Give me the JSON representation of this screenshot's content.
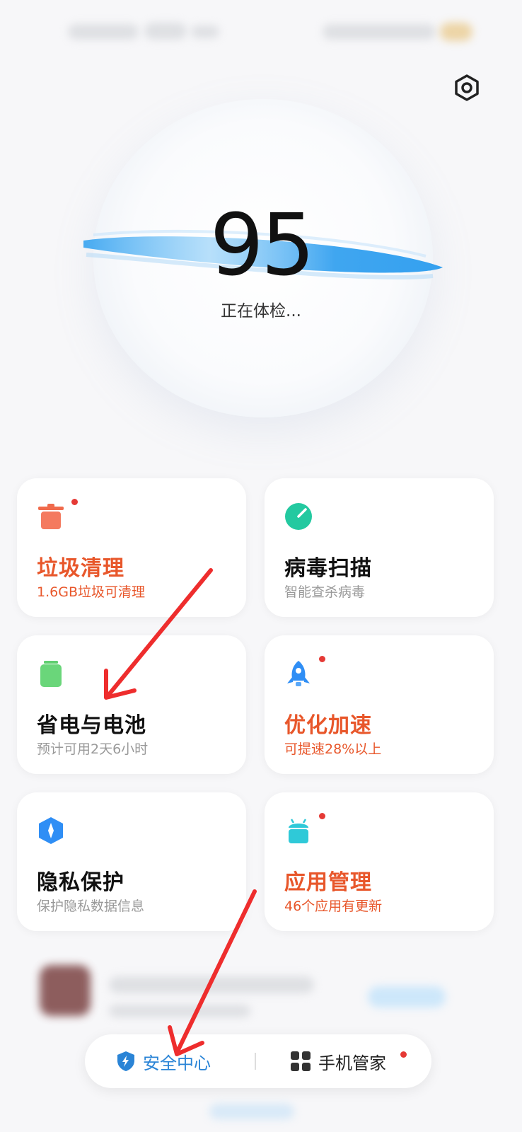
{
  "score": {
    "value": "95",
    "status": "正在体检..."
  },
  "cards": [
    {
      "title": "垃圾清理",
      "sub": "1.6GB垃圾可清理",
      "icon": "trash-icon",
      "badge": true,
      "warn": true
    },
    {
      "title": "病毒扫描",
      "sub": "智能查杀病毒",
      "icon": "virus-scan-icon",
      "badge": false,
      "warn": false
    },
    {
      "title": "省电与电池",
      "sub": "预计可用2天6小时",
      "icon": "battery-icon",
      "badge": false,
      "warn": false
    },
    {
      "title": "优化加速",
      "sub": "可提速28%以上",
      "icon": "rocket-icon",
      "badge": true,
      "warn": true
    },
    {
      "title": "隐私保护",
      "sub": "保护隐私数据信息",
      "icon": "privacy-shield-icon",
      "badge": false,
      "warn": false
    },
    {
      "title": "应用管理",
      "sub": "46个应用有更新",
      "icon": "android-icon",
      "badge": true,
      "warn": true
    }
  ],
  "tabbar": {
    "security_center": "安全中心",
    "phone_manager": "手机管家"
  },
  "colors": {
    "accent": "#2a84d6",
    "warning": "#e8572b",
    "badge": "#e53935"
  }
}
